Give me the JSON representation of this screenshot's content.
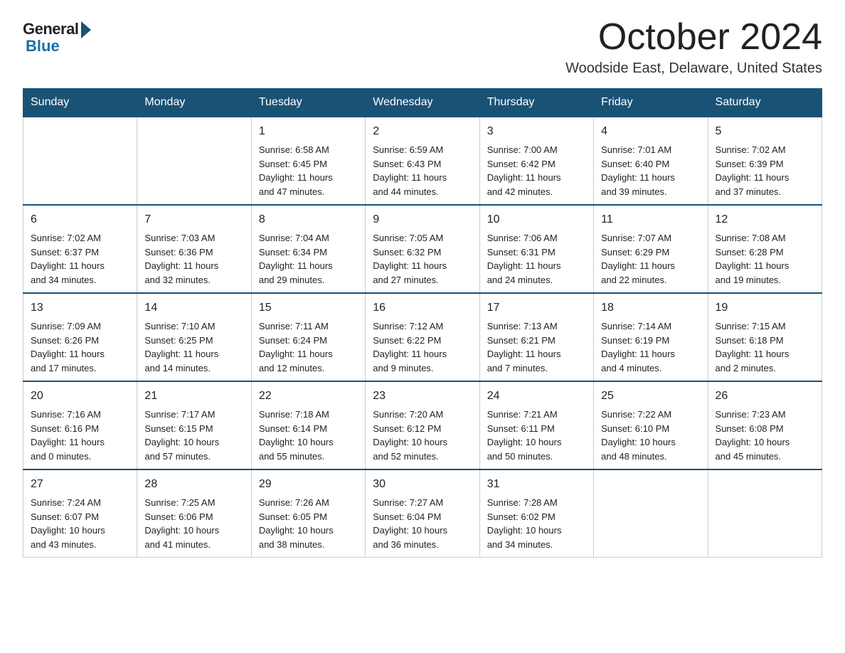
{
  "logo": {
    "general": "General",
    "blue": "Blue"
  },
  "title": "October 2024",
  "location": "Woodside East, Delaware, United States",
  "weekdays": [
    "Sunday",
    "Monday",
    "Tuesday",
    "Wednesday",
    "Thursday",
    "Friday",
    "Saturday"
  ],
  "weeks": [
    [
      {
        "day": "",
        "content": ""
      },
      {
        "day": "",
        "content": ""
      },
      {
        "day": "1",
        "content": "Sunrise: 6:58 AM\nSunset: 6:45 PM\nDaylight: 11 hours\nand 47 minutes."
      },
      {
        "day": "2",
        "content": "Sunrise: 6:59 AM\nSunset: 6:43 PM\nDaylight: 11 hours\nand 44 minutes."
      },
      {
        "day": "3",
        "content": "Sunrise: 7:00 AM\nSunset: 6:42 PM\nDaylight: 11 hours\nand 42 minutes."
      },
      {
        "day": "4",
        "content": "Sunrise: 7:01 AM\nSunset: 6:40 PM\nDaylight: 11 hours\nand 39 minutes."
      },
      {
        "day": "5",
        "content": "Sunrise: 7:02 AM\nSunset: 6:39 PM\nDaylight: 11 hours\nand 37 minutes."
      }
    ],
    [
      {
        "day": "6",
        "content": "Sunrise: 7:02 AM\nSunset: 6:37 PM\nDaylight: 11 hours\nand 34 minutes."
      },
      {
        "day": "7",
        "content": "Sunrise: 7:03 AM\nSunset: 6:36 PM\nDaylight: 11 hours\nand 32 minutes."
      },
      {
        "day": "8",
        "content": "Sunrise: 7:04 AM\nSunset: 6:34 PM\nDaylight: 11 hours\nand 29 minutes."
      },
      {
        "day": "9",
        "content": "Sunrise: 7:05 AM\nSunset: 6:32 PM\nDaylight: 11 hours\nand 27 minutes."
      },
      {
        "day": "10",
        "content": "Sunrise: 7:06 AM\nSunset: 6:31 PM\nDaylight: 11 hours\nand 24 minutes."
      },
      {
        "day": "11",
        "content": "Sunrise: 7:07 AM\nSunset: 6:29 PM\nDaylight: 11 hours\nand 22 minutes."
      },
      {
        "day": "12",
        "content": "Sunrise: 7:08 AM\nSunset: 6:28 PM\nDaylight: 11 hours\nand 19 minutes."
      }
    ],
    [
      {
        "day": "13",
        "content": "Sunrise: 7:09 AM\nSunset: 6:26 PM\nDaylight: 11 hours\nand 17 minutes."
      },
      {
        "day": "14",
        "content": "Sunrise: 7:10 AM\nSunset: 6:25 PM\nDaylight: 11 hours\nand 14 minutes."
      },
      {
        "day": "15",
        "content": "Sunrise: 7:11 AM\nSunset: 6:24 PM\nDaylight: 11 hours\nand 12 minutes."
      },
      {
        "day": "16",
        "content": "Sunrise: 7:12 AM\nSunset: 6:22 PM\nDaylight: 11 hours\nand 9 minutes."
      },
      {
        "day": "17",
        "content": "Sunrise: 7:13 AM\nSunset: 6:21 PM\nDaylight: 11 hours\nand 7 minutes."
      },
      {
        "day": "18",
        "content": "Sunrise: 7:14 AM\nSunset: 6:19 PM\nDaylight: 11 hours\nand 4 minutes."
      },
      {
        "day": "19",
        "content": "Sunrise: 7:15 AM\nSunset: 6:18 PM\nDaylight: 11 hours\nand 2 minutes."
      }
    ],
    [
      {
        "day": "20",
        "content": "Sunrise: 7:16 AM\nSunset: 6:16 PM\nDaylight: 11 hours\nand 0 minutes."
      },
      {
        "day": "21",
        "content": "Sunrise: 7:17 AM\nSunset: 6:15 PM\nDaylight: 10 hours\nand 57 minutes."
      },
      {
        "day": "22",
        "content": "Sunrise: 7:18 AM\nSunset: 6:14 PM\nDaylight: 10 hours\nand 55 minutes."
      },
      {
        "day": "23",
        "content": "Sunrise: 7:20 AM\nSunset: 6:12 PM\nDaylight: 10 hours\nand 52 minutes."
      },
      {
        "day": "24",
        "content": "Sunrise: 7:21 AM\nSunset: 6:11 PM\nDaylight: 10 hours\nand 50 minutes."
      },
      {
        "day": "25",
        "content": "Sunrise: 7:22 AM\nSunset: 6:10 PM\nDaylight: 10 hours\nand 48 minutes."
      },
      {
        "day": "26",
        "content": "Sunrise: 7:23 AM\nSunset: 6:08 PM\nDaylight: 10 hours\nand 45 minutes."
      }
    ],
    [
      {
        "day": "27",
        "content": "Sunrise: 7:24 AM\nSunset: 6:07 PM\nDaylight: 10 hours\nand 43 minutes."
      },
      {
        "day": "28",
        "content": "Sunrise: 7:25 AM\nSunset: 6:06 PM\nDaylight: 10 hours\nand 41 minutes."
      },
      {
        "day": "29",
        "content": "Sunrise: 7:26 AM\nSunset: 6:05 PM\nDaylight: 10 hours\nand 38 minutes."
      },
      {
        "day": "30",
        "content": "Sunrise: 7:27 AM\nSunset: 6:04 PM\nDaylight: 10 hours\nand 36 minutes."
      },
      {
        "day": "31",
        "content": "Sunrise: 7:28 AM\nSunset: 6:02 PM\nDaylight: 10 hours\nand 34 minutes."
      },
      {
        "day": "",
        "content": ""
      },
      {
        "day": "",
        "content": ""
      }
    ]
  ]
}
